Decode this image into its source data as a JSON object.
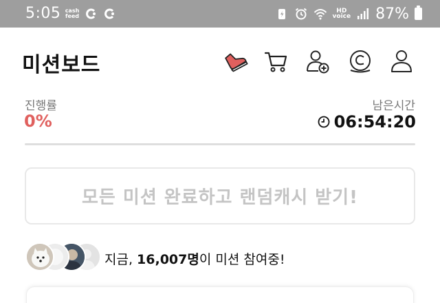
{
  "status_bar": {
    "time": "5:05",
    "cashfeed_top": "cash",
    "cashfeed_bottom": "feed",
    "hd_top": "HD",
    "hd_bottom": "voice",
    "battery": "87%"
  },
  "header": {
    "title": "미션보드",
    "icons": [
      "shoe-icon",
      "cart-icon",
      "add-friend-icon",
      "coin-icon",
      "user-icon"
    ],
    "accent_color": "#e0605e"
  },
  "progress": {
    "label": "진행률",
    "value": "0%"
  },
  "remaining": {
    "label": "남은시간",
    "value": "06:54:20"
  },
  "claim_button": {
    "label": "모든 미션 완료하고 랜덤캐시 받기!"
  },
  "participants": {
    "prefix": "지금, ",
    "count": "16,007명",
    "suffix": "이 미션 참여중!"
  }
}
